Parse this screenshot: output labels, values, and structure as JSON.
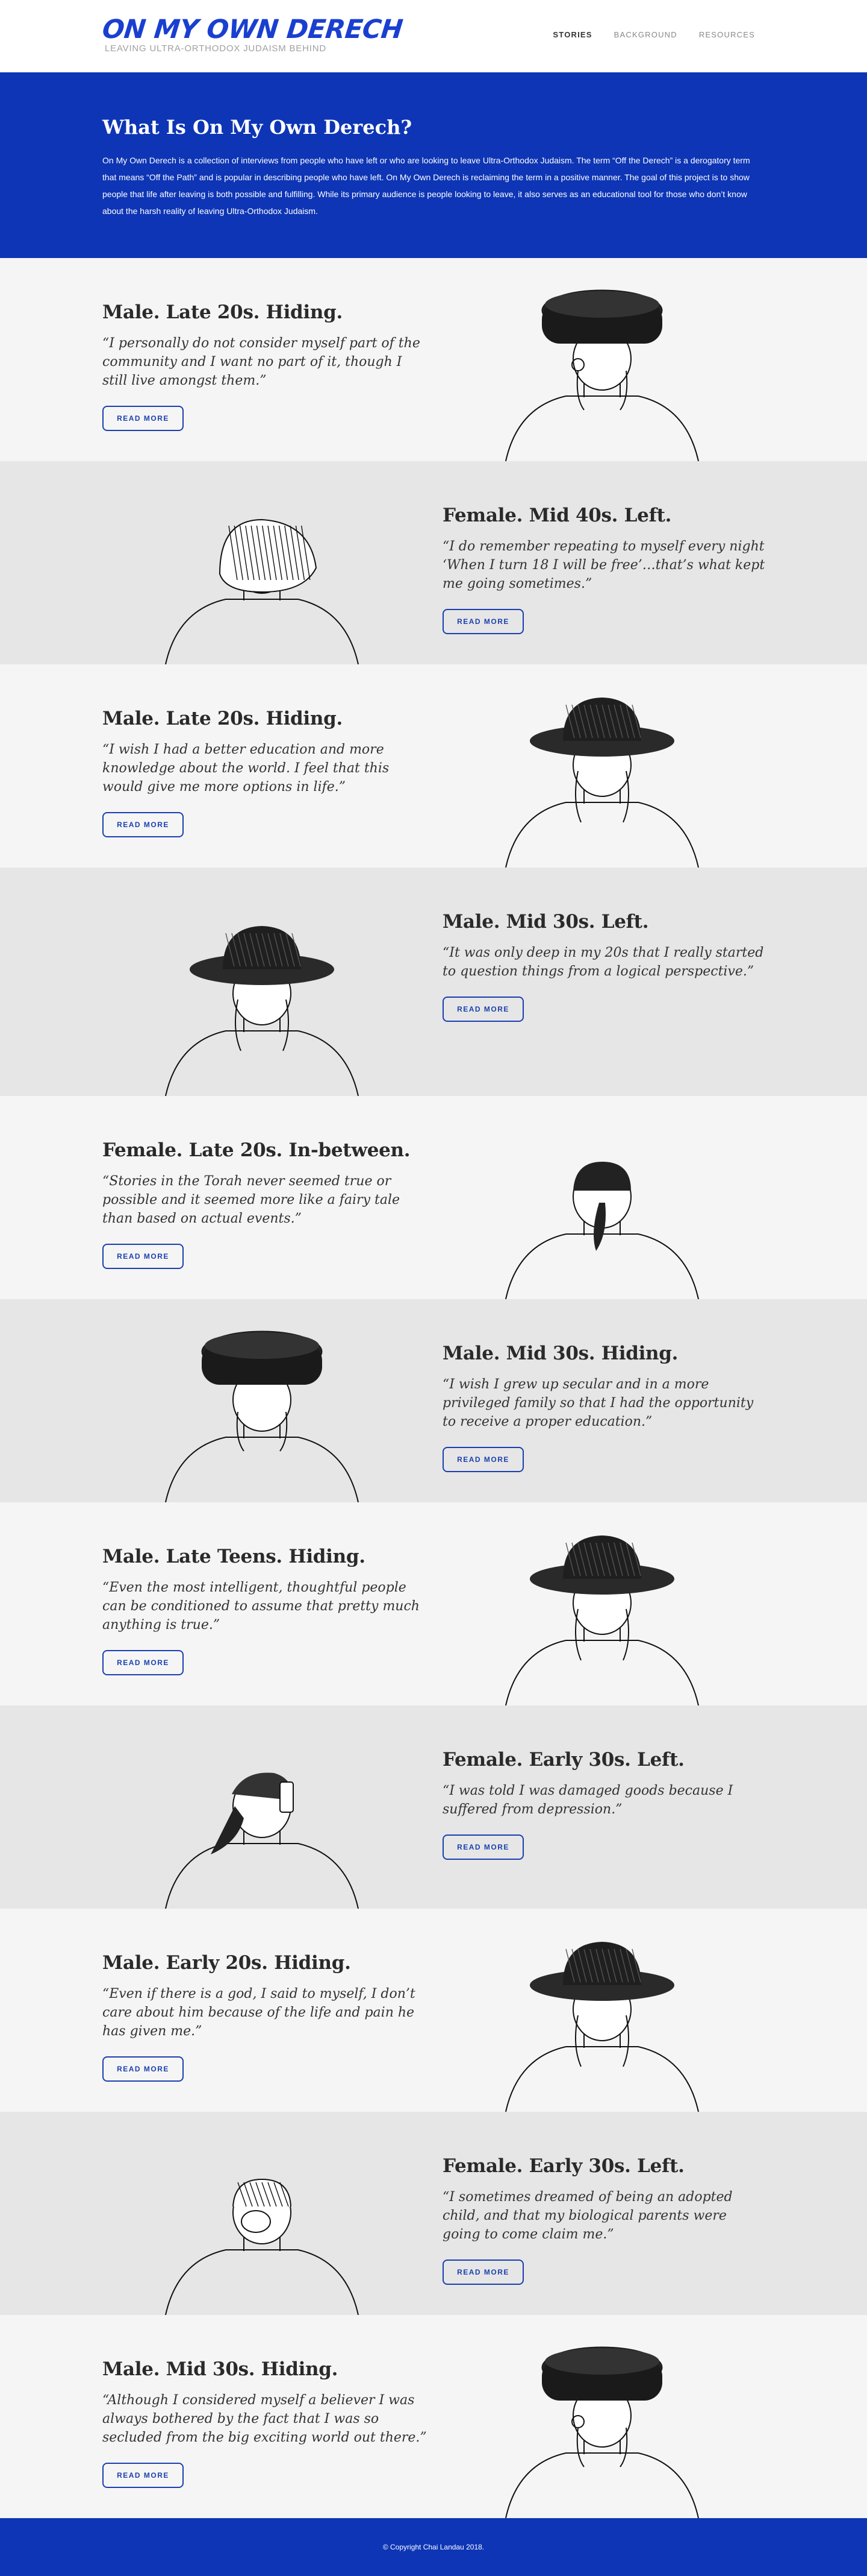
{
  "header": {
    "logo_title": "ON MY OWN DERECH",
    "logo_subtitle": "LEAVING ULTRA-ORTHODOX JUDAISM BEHIND",
    "nav": [
      "STORIES",
      "BACKGROUND",
      "RESOURCES"
    ]
  },
  "intro": {
    "title": "What Is On My Own Derech?",
    "body": "On My Own Derech is a collection of interviews from people who have left or who are looking to leave Ultra-Orthodox Judaism. The term “Off the Derech” is a derogatory term that means “Off the Path” and is popular in describing people who have left. On My Own Derech is reclaiming the term in a positive manner. The goal of this project is to show people that life after leaving is both possible and fulfilling. While its primary audience is people looking to leave, it also serves as an educational tool for those who don’t know about the harsh reality of leaving Ultra-Orthodox Judaism."
  },
  "read_more_label": "READ MORE",
  "stories": [
    {
      "title": "Male. Late 20s. Hiding.",
      "quote": "“I personally do not consider myself part of the community and I want no part of it, though I still live amongst them.”",
      "icon": "man-fur-hat-glasses-illustration"
    },
    {
      "title": "Female. Mid 40s. Left.",
      "quote": "“I do remember repeating to myself every night ‘When I turn 18 I will be free’…that’s what kept me going sometimes.”",
      "icon": "woman-headscarf-illustration"
    },
    {
      "title": "Male. Late 20s. Hiding.",
      "quote": "“I wish I had a better education and more knowledge about the world. I feel that this would give me more options in life.”",
      "icon": "man-brimmed-hat-illustration"
    },
    {
      "title": "Male. Mid 30s. Left.",
      "quote": "“It was only deep in my 20s that I really started to question things from a logical perspective.”",
      "icon": "man-fedora-illustration"
    },
    {
      "title": "Female. Late 20s. In-between.",
      "quote": "“Stories in the Torah never seemed true or possible and it seemed more like a fairy tale than based on actual events.”",
      "icon": "woman-ponytail-illustration"
    },
    {
      "title": "Male. Mid 30s. Hiding.",
      "quote": "“I wish I grew up secular and in a more privileged family so that I had the opportunity to receive a proper education.”",
      "icon": "man-shtreimel-illustration"
    },
    {
      "title": "Male. Late Teens. Hiding.",
      "quote": "“Even the most intelligent, thoughtful people can be conditioned to assume that pretty much anything is true.”",
      "icon": "man-straw-hat-illustration"
    },
    {
      "title": "Female. Early 30s. Left.",
      "quote": "“I was told I was damaged goods because I suffered from depression.”",
      "icon": "woman-phone-illustration"
    },
    {
      "title": "Male. Early 20s. Hiding.",
      "quote": "“Even if there is a god, I said to myself, I don’t care about him because of the life and pain he has given me.”",
      "icon": "man-wide-hat-illustration"
    },
    {
      "title": "Female. Early 30s. Left.",
      "quote": "“I sometimes dreamed of being an adopted child, and that my biological parents were going to come claim me.”",
      "icon": "woman-bun-illustration"
    },
    {
      "title": "Male. Mid 30s. Hiding.",
      "quote": "“Although I considered myself a believer I was always bothered by the fact that I was so secluded from the big exciting world out there.”",
      "icon": "man-fur-hat-glasses-illustration"
    }
  ],
  "footer": {
    "copyright": "© Copyright Chai Landau 2018."
  }
}
